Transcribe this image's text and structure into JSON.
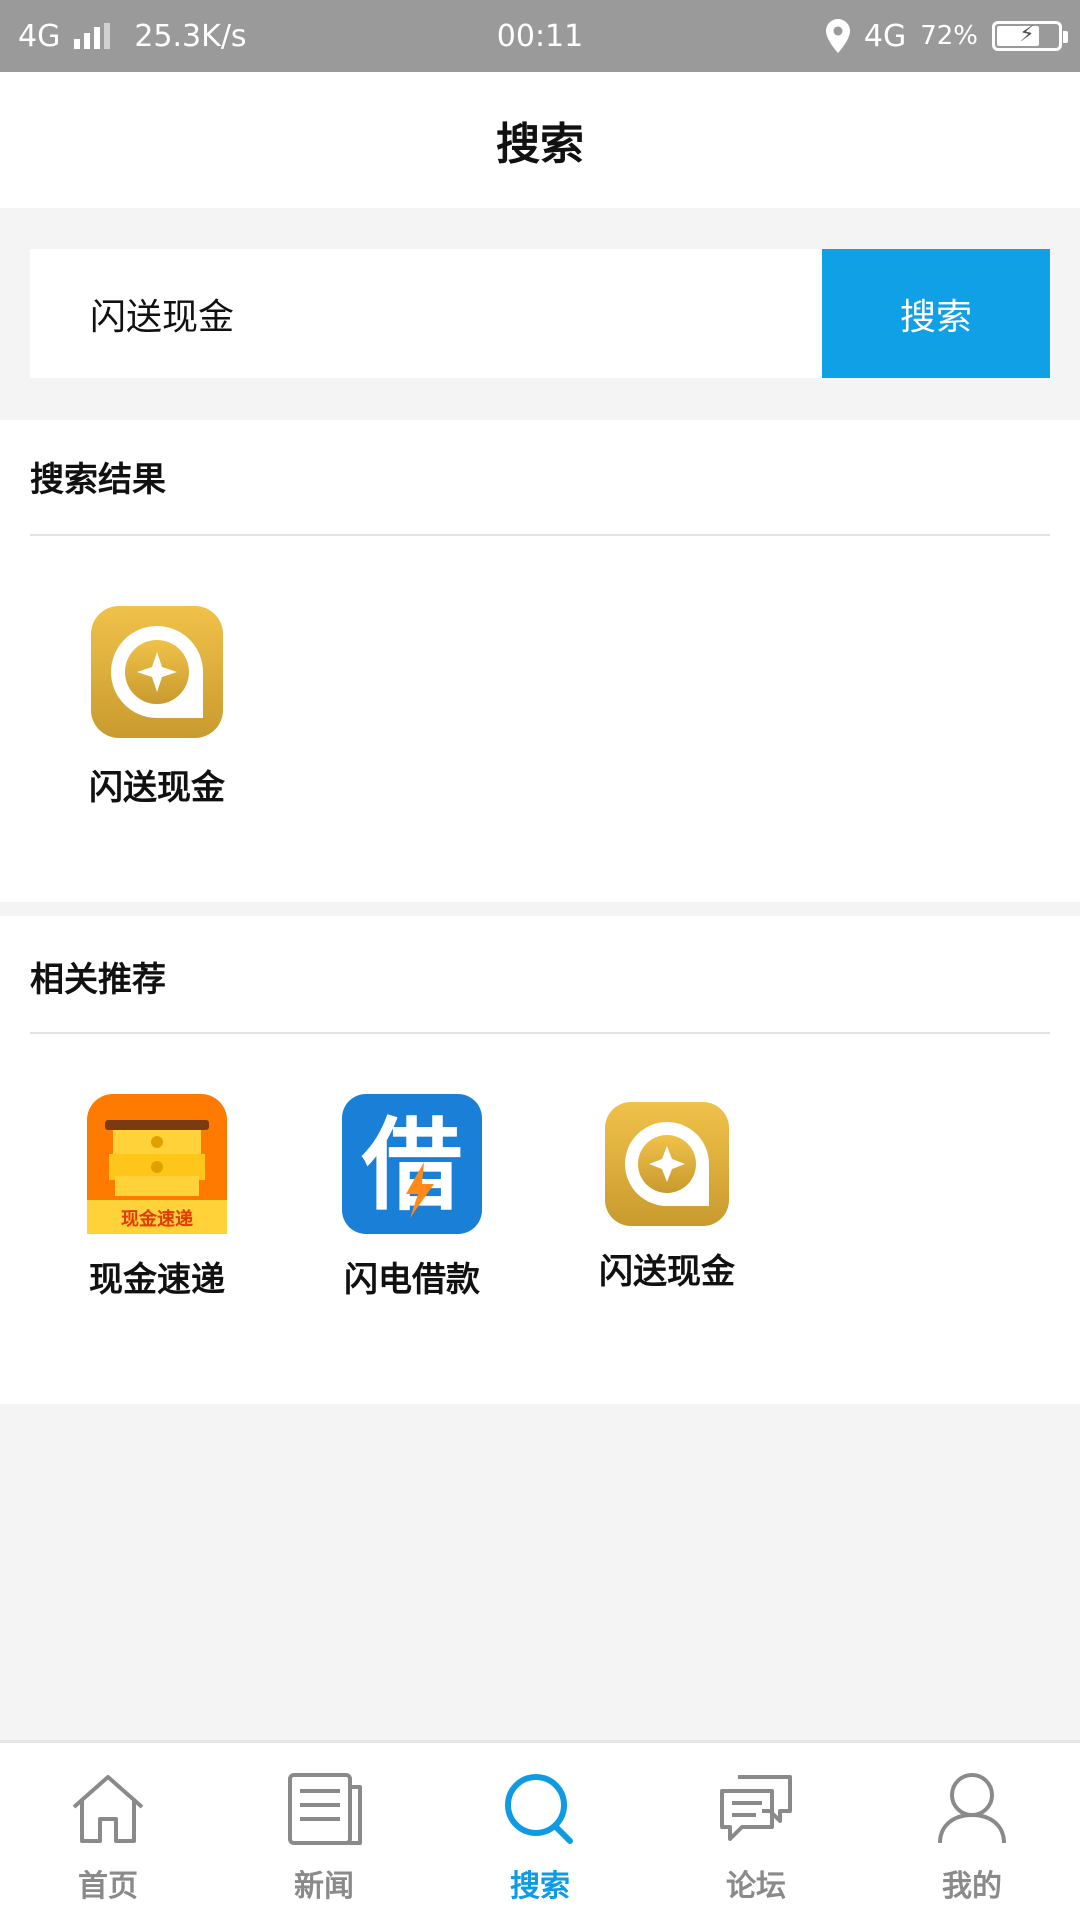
{
  "status_bar": {
    "network": "4G",
    "speed": "25.3K/s",
    "time": "00:11",
    "network_right": "4G",
    "battery": "72%",
    "battery_level": 0.72
  },
  "header": {
    "title": "搜索"
  },
  "search": {
    "value": "闪送现金",
    "button_label": "搜索"
  },
  "results": {
    "title": "搜索结果",
    "items": [
      {
        "label": "闪送现金",
        "icon": "gold-coin-app-icon"
      }
    ]
  },
  "recommendations": {
    "title": "相关推荐",
    "items": [
      {
        "label": "现金速递",
        "icon": "cash-express-app-icon",
        "icon_text": "现金速递"
      },
      {
        "label": "闪电借款",
        "icon": "borrow-app-icon",
        "icon_text": "借"
      },
      {
        "label": "闪送现金",
        "icon": "gold-coin-app-icon"
      }
    ]
  },
  "bottom_nav": {
    "items": [
      {
        "label": "首页",
        "icon": "home-icon"
      },
      {
        "label": "新闻",
        "icon": "news-icon"
      },
      {
        "label": "搜索",
        "icon": "search-icon",
        "active": true
      },
      {
        "label": "论坛",
        "icon": "chat-icon"
      },
      {
        "label": "我的",
        "icon": "user-icon"
      }
    ]
  },
  "colors": {
    "accent": "#0fa0e6",
    "status_bar": "#9a9a9a",
    "background": "#f4f4f4",
    "gold": "#d9a93a",
    "orange": "#ff7a00"
  }
}
